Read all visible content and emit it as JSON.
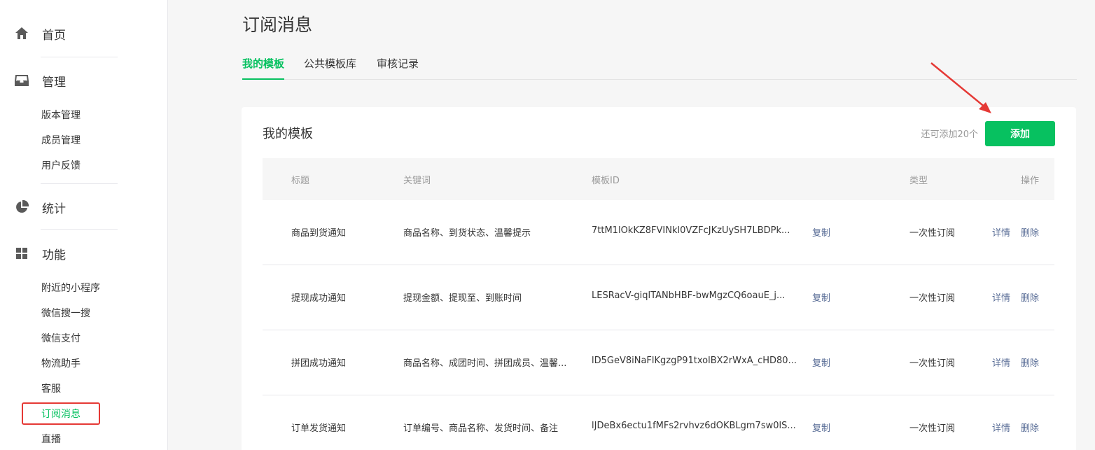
{
  "sidebar": {
    "home": {
      "label": "首页",
      "icon": "home-icon"
    },
    "manage": {
      "label": "管理",
      "icon": "inbox-icon",
      "items": [
        "版本管理",
        "成员管理",
        "用户反馈"
      ]
    },
    "stats": {
      "label": "统计",
      "icon": "pie-chart-icon"
    },
    "features": {
      "label": "功能",
      "icon": "grid-icon",
      "items": [
        "附近的小程序",
        "微信搜一搜",
        "微信支付",
        "物流助手",
        "客服",
        "订阅消息",
        "直播"
      ]
    },
    "active_item": "订阅消息"
  },
  "page": {
    "title": "订阅消息",
    "tabs": [
      "我的模板",
      "公共模板库",
      "审核记录"
    ],
    "active_tab": "我的模板"
  },
  "card": {
    "title": "我的模板",
    "remaining": "还可添加20个",
    "add_label": "添加"
  },
  "table": {
    "headers": {
      "title": "标题",
      "keywords": "关键词",
      "template_id": "模板ID",
      "type": "类型",
      "actions": "操作"
    },
    "rows": [
      {
        "title": "商品到货通知",
        "keywords": "商品名称、到货状态、温馨提示",
        "template_id": "7ttM1lOkKZ8FVINkl0VZFcJKzUySH7LBDPk...",
        "copy": "复制",
        "type": "一次性订阅",
        "detail": "详情",
        "delete": "删除"
      },
      {
        "title": "提现成功通知",
        "keywords": "提现金额、提现至、到账时间",
        "template_id": "LESRacV-giqlTANbHBF-bwMgzCQ6oauE_j...",
        "copy": "复制",
        "type": "一次性订阅",
        "detail": "详情",
        "delete": "删除"
      },
      {
        "title": "拼团成功通知",
        "keywords": "商品名称、成团时间、拼团成员、温馨...",
        "template_id": "lD5GeV8iNaFlKgzgP91txolBX2rWxA_cHD80...",
        "copy": "复制",
        "type": "一次性订阅",
        "detail": "详情",
        "delete": "删除"
      },
      {
        "title": "订单发货通知",
        "keywords": "订单编号、商品名称、发货时间、备注",
        "template_id": "lJDeBx6ectu1fMFs2rvhvz6dOKBLgm7sw0lS...",
        "copy": "复制",
        "type": "一次性订阅",
        "detail": "详情",
        "delete": "删除"
      }
    ]
  },
  "colors": {
    "accent": "#07c160",
    "link": "#576b95",
    "highlight": "#e53935"
  }
}
